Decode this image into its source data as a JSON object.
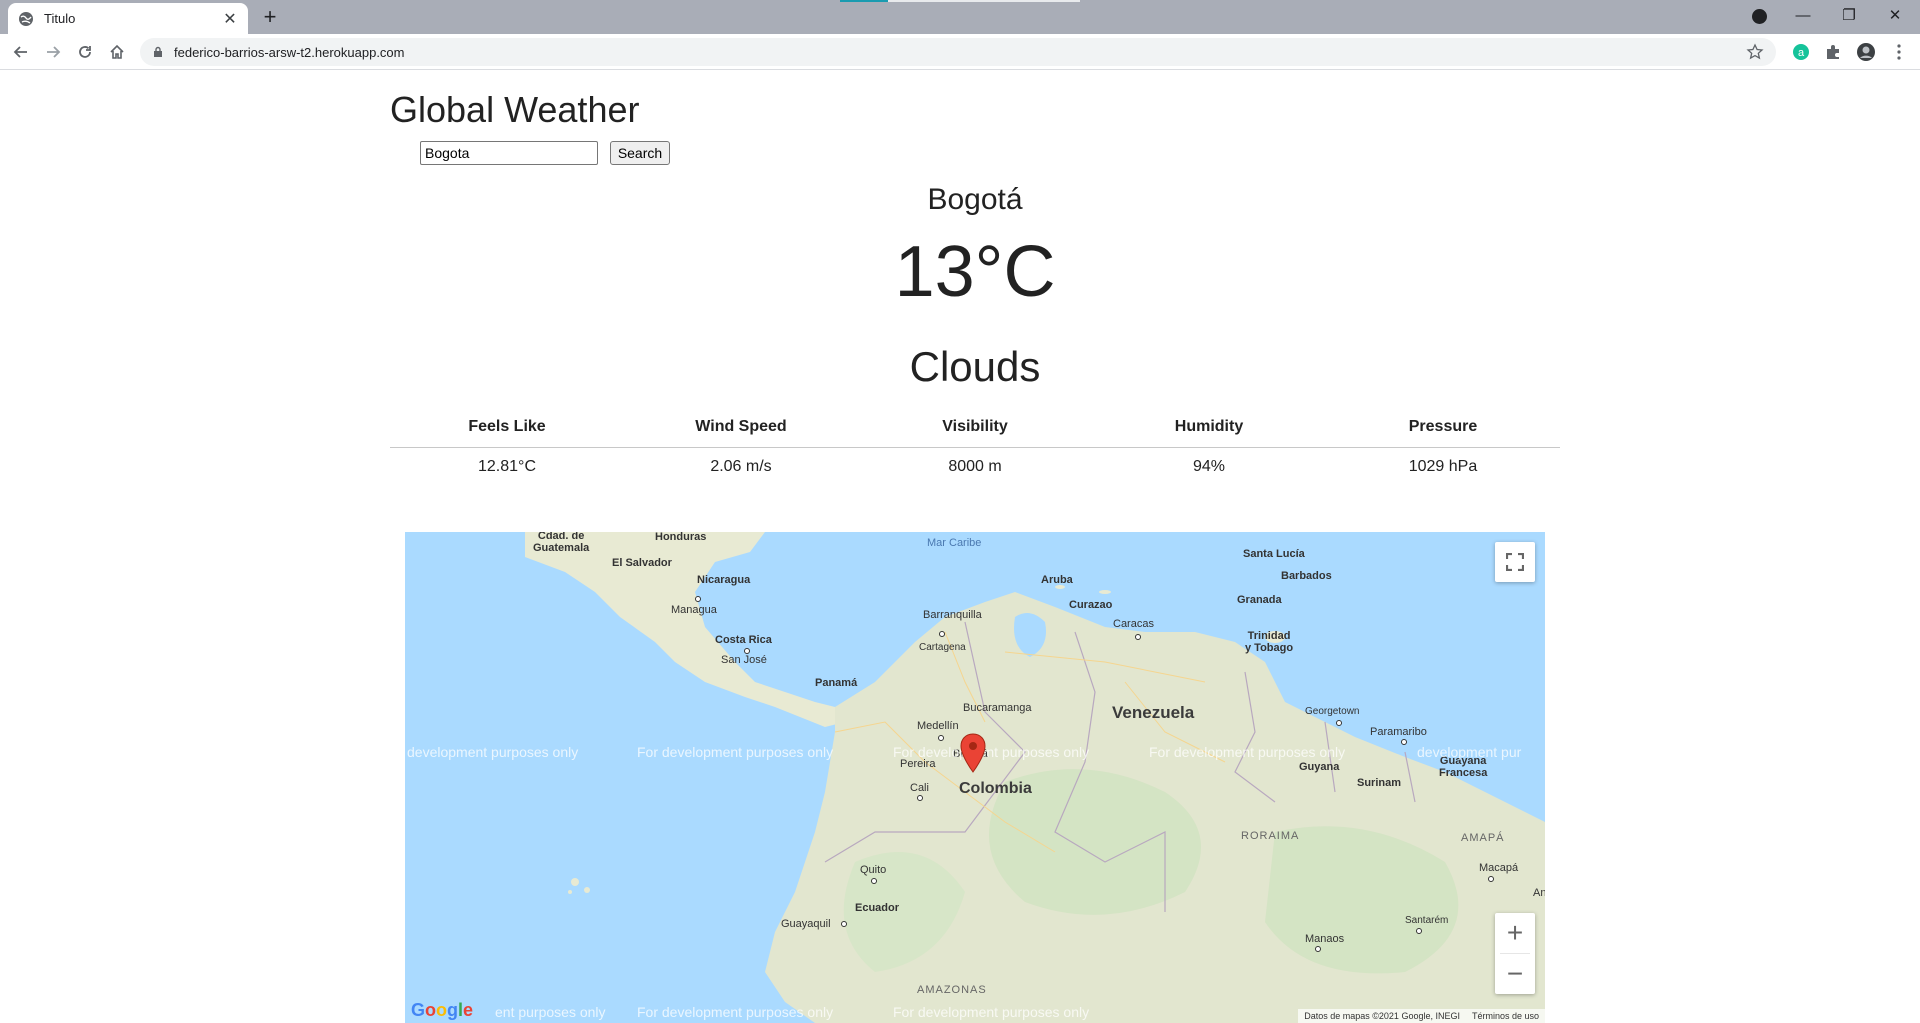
{
  "browser": {
    "tab_title": "Titulo",
    "tab_close": "✕",
    "new_tab": "+",
    "url": "federico-barrios-arsw-t2.herokuapp.com",
    "window_controls": {
      "minimize": "—",
      "restore": "❐",
      "close": "✕"
    }
  },
  "app": {
    "title": "Global Weather",
    "search": {
      "value": "Bogota",
      "button_label": "Search"
    }
  },
  "weather": {
    "city": "Bogotá",
    "temperature": "13°C",
    "condition": "Clouds",
    "stats": {
      "headers": [
        "Feels Like",
        "Wind Speed",
        "Visibility",
        "Humidity",
        "Pressure"
      ],
      "values": [
        "12.81°C",
        "2.06 m/s",
        "8000 m",
        "94%",
        "1029 hPa"
      ]
    }
  },
  "map": {
    "labels": {
      "guatemala": "Cdad. de\nGuatemala",
      "honduras": "Honduras",
      "el_salvador": "El Salvador",
      "nicaragua": "Nicaragua",
      "managua": "Managua",
      "costa_rica": "Costa Rica",
      "san_jose": "San José",
      "panama": "Panamá",
      "mar_caribe": "Mar Caribe",
      "aruba": "Aruba",
      "curazao": "Curazao",
      "barranquilla": "Barranquilla",
      "cartagena": "Cartagena",
      "caracas": "Caracas",
      "santa_lucia": "Santa Lucía",
      "barbados": "Barbados",
      "granada": "Granada",
      "trinidad": "Trinidad\ny Tobago",
      "bucaramanga": "Bucaramanga",
      "venezuela": "Venezuela",
      "medellin": "Medellín",
      "pereira": "Pereira",
      "bogota": "Bogotá",
      "colombia": "Colombia",
      "cali": "Cali",
      "georgetown": "Georgetown",
      "paramaribo": "Paramaribo",
      "guyana": "Guyana",
      "surinam": "Surinam",
      "guayana_francesa": "Guayana\nFrancesa",
      "roraima": "RORAIMA",
      "amapa": "AMAPÁ",
      "macapa": "Macapá",
      "quito": "Quito",
      "ecuador": "Ecuador",
      "guayaquil": "Guayaquil",
      "santarem": "Santarém",
      "manaos": "Manaos",
      "amazonas": "AMAZONAS",
      "an": "An"
    },
    "watermark": "For development purposes only",
    "watermark_left": "development purposes only",
    "watermark_left_bottom": "ent purposes only",
    "watermark_right": "development pur",
    "google_logo": "Google",
    "footer_data": "Datos de mapas ©2021 Google, INEGI",
    "footer_terms": "Términos de uso",
    "zoom_in": "+",
    "zoom_out": "−"
  }
}
